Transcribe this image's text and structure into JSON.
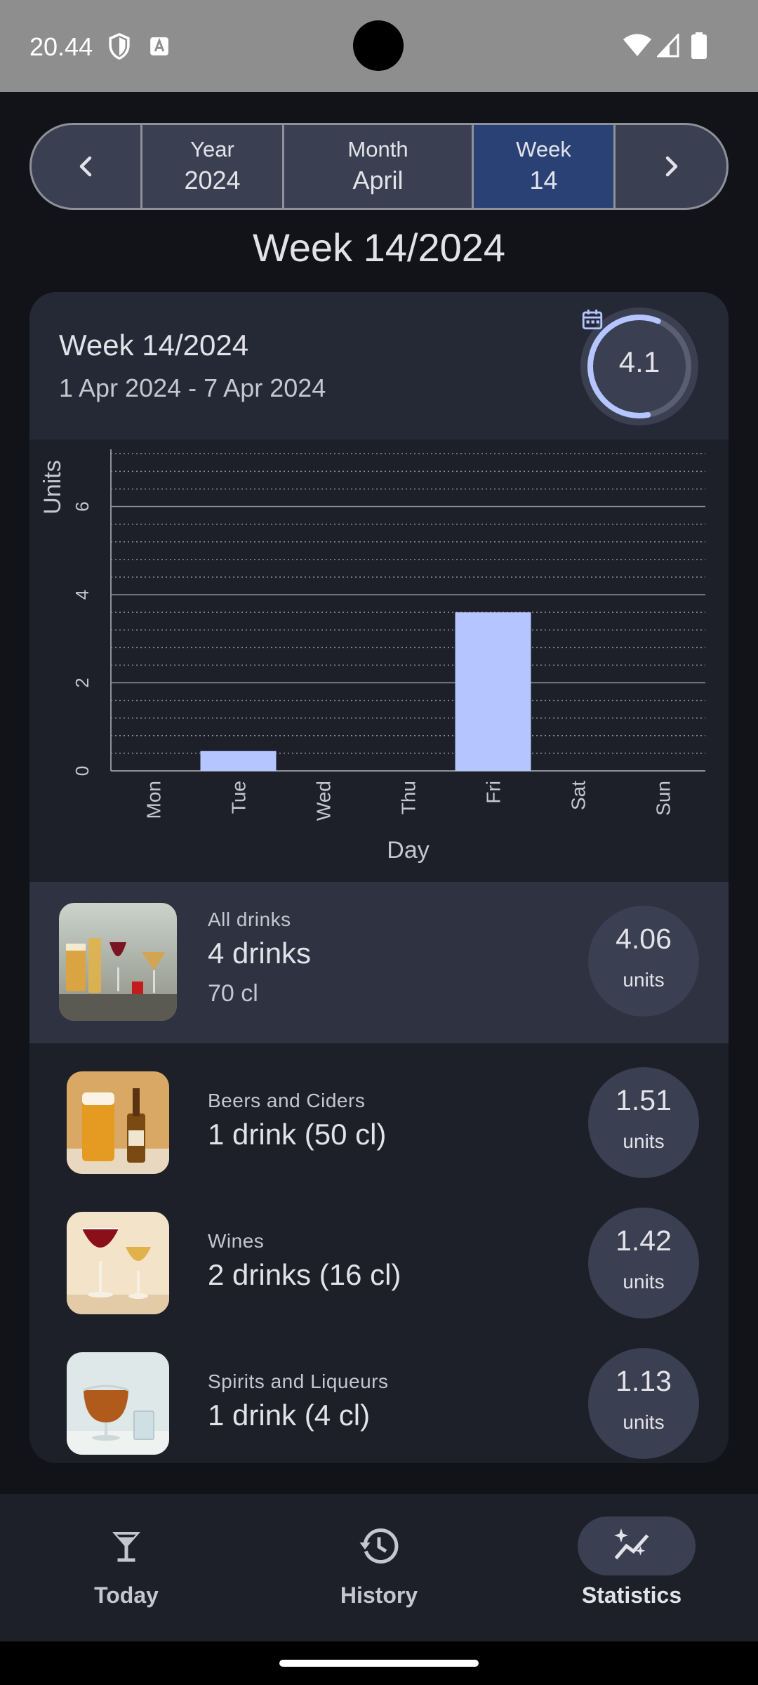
{
  "status_bar": {
    "time": "20.44",
    "icons": [
      "shield-icon",
      "font-a-icon",
      "wifi-icon",
      "signal-icon",
      "battery-icon"
    ]
  },
  "period_selector": {
    "prev_icon": "chevron-left-icon",
    "next_icon": "chevron-right-icon",
    "year": {
      "label": "Year",
      "value": "2024"
    },
    "month": {
      "label": "Month",
      "value": "April"
    },
    "week": {
      "label": "Week",
      "value": "14",
      "selected": true
    }
  },
  "page_title": "Week 14/2024",
  "summary": {
    "title": "Week 14/2024",
    "date_range": "1 Apr 2024 - 7 Apr 2024",
    "gauge_value": "4.1",
    "gauge_fraction": 0.59,
    "gauge_icon": "calendar-icon"
  },
  "chart_data": {
    "type": "bar",
    "categories": [
      "Mon",
      "Tue",
      "Wed",
      "Thu",
      "Fri",
      "Sat",
      "Sun"
    ],
    "values": [
      0,
      0.45,
      0,
      0,
      3.6,
      0,
      0
    ],
    "xlabel": "Day",
    "ylabel": "Units",
    "ylim": [
      0,
      7.3
    ],
    "yticks": [
      0,
      2,
      4,
      6
    ],
    "minor_gridline_step": 0.4,
    "grid": true,
    "bar_color": "#b4c5ff"
  },
  "all_drinks": {
    "caption": "All drinks",
    "main": "4 drinks",
    "sub": "70 cl",
    "units_value": "4.06",
    "units_label": "units"
  },
  "categories": [
    {
      "caption": "Beers and Ciders",
      "main": "1 drink (50 cl)",
      "units_value": "1.51",
      "units_label": "units"
    },
    {
      "caption": "Wines",
      "main": "2 drinks (16 cl)",
      "units_value": "1.42",
      "units_label": "units"
    },
    {
      "caption": "Spirits and Liqueurs",
      "main": "1 drink (4 cl)",
      "units_value": "1.13",
      "units_label": "units"
    }
  ],
  "bottom_nav": {
    "today": {
      "label": "Today",
      "icon": "cocktail-glass-icon"
    },
    "history": {
      "label": "History",
      "icon": "history-icon"
    },
    "statistics": {
      "label": "Statistics",
      "icon": "sparkle-chart-icon",
      "active": true
    }
  },
  "colors": {
    "background": "#121318",
    "card": "#1d2029",
    "accent": "#b4c5ff",
    "selected_segment": "#2a4176"
  }
}
